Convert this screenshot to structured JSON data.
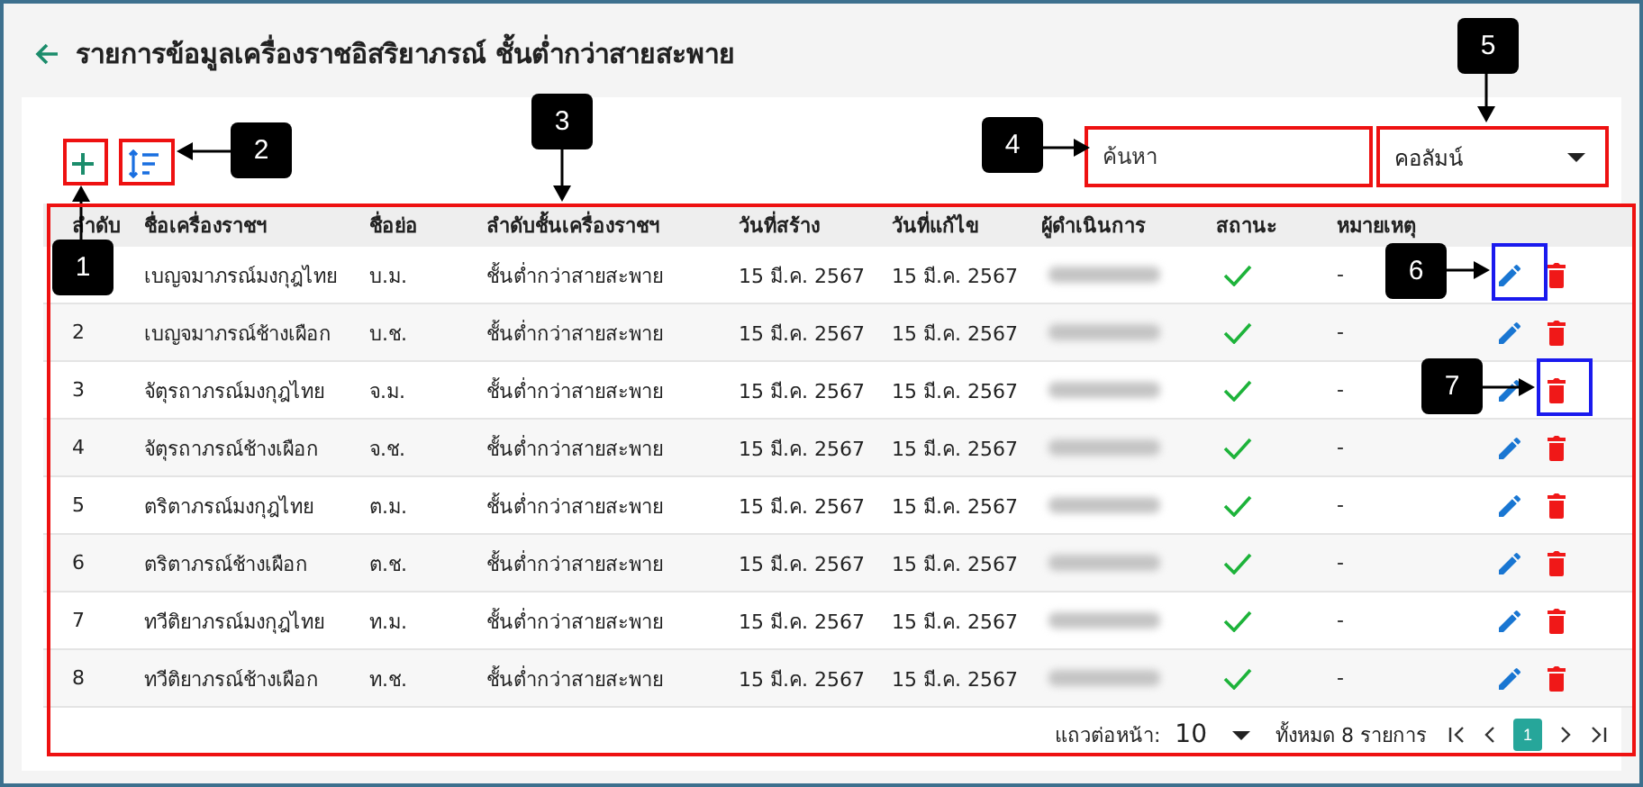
{
  "title": "รายการข้อมูลเครื่องราชอิสริยาภรณ์ ชั้นต่ำกว่าสายสะพาย",
  "search": {
    "placeholder": "ค้นหา"
  },
  "column_select": {
    "value": "คอลัมน์"
  },
  "table": {
    "columns": [
      "ลำดับ",
      "ชื่อเครื่องราชฯ",
      "ชื่อย่อ",
      "ลำดับชั้นเครื่องราชฯ",
      "วันที่สร้าง",
      "วันที่แก้ไข",
      "ผู้ดำเนินการ",
      "สถานะ",
      "หมายเหตุ"
    ],
    "rows": [
      {
        "name": "เบญจมาภรณ์มงกุฎไทย",
        "abbr": "บ.ม.",
        "class": "ชั้นต่ำกว่าสายสะพาย",
        "created": "15 มี.ค. 2567",
        "modified": "15 มี.ค. 2567",
        "active": true,
        "note": "-"
      },
      {
        "no": "2",
        "name": "เบญจมาภรณ์ช้างเผือก",
        "abbr": "บ.ช.",
        "class": "ชั้นต่ำกว่าสายสะพาย",
        "created": "15 มี.ค. 2567",
        "modified": "15 มี.ค. 2567",
        "active": true,
        "note": "-"
      },
      {
        "no": "3",
        "name": "จัตุรถาภรณ์มงกุฎไทย",
        "abbr": "จ.ม.",
        "class": "ชั้นต่ำกว่าสายสะพาย",
        "created": "15 มี.ค. 2567",
        "modified": "15 มี.ค. 2567",
        "active": true,
        "note": "-"
      },
      {
        "no": "4",
        "name": "จัตุรถาภรณ์ช้างเผือก",
        "abbr": "จ.ช.",
        "class": "ชั้นต่ำกว่าสายสะพาย",
        "created": "15 มี.ค. 2567",
        "modified": "15 มี.ค. 2567",
        "active": true,
        "note": "-"
      },
      {
        "no": "5",
        "name": "ตริตาภรณ์มงกุฎไทย",
        "abbr": "ต.ม.",
        "class": "ชั้นต่ำกว่าสายสะพาย",
        "created": "15 มี.ค. 2567",
        "modified": "15 มี.ค. 2567",
        "active": true,
        "note": "-"
      },
      {
        "no": "6",
        "name": "ตริตาภรณ์ช้างเผือก",
        "abbr": "ต.ช.",
        "class": "ชั้นต่ำกว่าสายสะพาย",
        "created": "15 มี.ค. 2567",
        "modified": "15 มี.ค. 2567",
        "active": true,
        "note": "-"
      },
      {
        "no": "7",
        "name": "ทวีติยาภรณ์มงกุฎไทย",
        "abbr": "ท.ม.",
        "class": "ชั้นต่ำกว่าสายสะพาย",
        "created": "15 มี.ค. 2567",
        "modified": "15 มี.ค. 2567",
        "active": true,
        "note": "-"
      },
      {
        "no": "8",
        "name": "ทวีติยาภรณ์ช้างเผือก",
        "abbr": "ท.ช.",
        "class": "ชั้นต่ำกว่าสายสะพาย",
        "created": "15 มี.ค. 2567",
        "modified": "15 มี.ค. 2567",
        "active": true,
        "note": "-"
      }
    ]
  },
  "pagination": {
    "rows_per_page_label": "แถวต่อหน้า:",
    "rows_per_page": "10",
    "total": "ทั้งหมด 8 รายการ",
    "pages": [
      {
        "label": "1",
        "selected": true
      }
    ]
  },
  "callouts": [
    {
      "label": "1",
      "color": "#ee1111"
    },
    {
      "label": "2",
      "color": "#ee1111"
    },
    {
      "label": "3",
      "color": "#ee1111"
    },
    {
      "label": "4",
      "color": "#ee1111"
    },
    {
      "label": "5",
      "color": "#ee1111"
    },
    {
      "label": "6",
      "color": "#1a1aee"
    },
    {
      "label": "7",
      "color": "#1a1aee"
    }
  ]
}
